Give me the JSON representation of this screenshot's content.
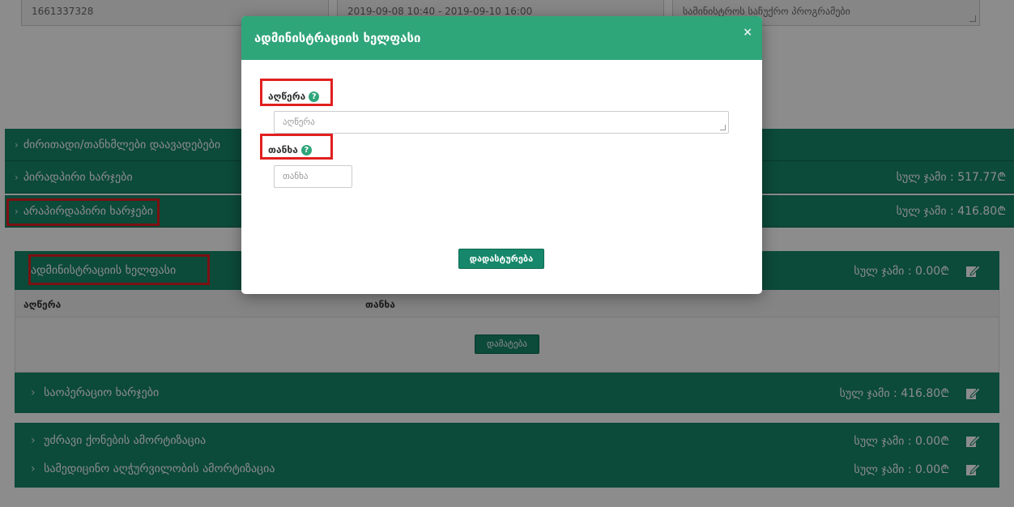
{
  "top_fields": {
    "id_value": "1661337328",
    "date_range": "2019-09-08 10:40 - 2019-09-10 16:00",
    "type_value": "სამინისტროს საჩუქრო პროგრამები"
  },
  "sections": {
    "main_funds": {
      "label": "ძირითადი/თანხმლები დაავადებები"
    },
    "direct_expenses": {
      "label": "პირადპირი ხარჯები",
      "total": "სულ ჯამი : 517.77₾"
    },
    "indirect_expenses": {
      "label": "არაპირდაპირი ხარჯები",
      "total": "სულ ჯამი : 416.80₾"
    }
  },
  "admin_section": {
    "label": "ადმინისტრაციის ხელფასი",
    "total": "სულ ჯამი : 0.00₾",
    "table_headers": [
      "აღწერა",
      "თანხა"
    ],
    "add_button": "დამატება"
  },
  "sub_sections": [
    {
      "label": "საოპერაციო ხარჯები",
      "total": "სულ ჯამი : 416.80₾"
    },
    {
      "label": "უძრავი ქონების ამორტიზაცია",
      "total": "სულ ჯამი : 0.00₾"
    },
    {
      "label": "სამედიცინო აღჭურვილობის ამორტიზაცია",
      "total": "სულ ჯამი : 0.00₾"
    }
  ],
  "modal": {
    "title": "ადმინისტრაციის ხელფასი",
    "close_glyph": "×",
    "description_label": "აღწერა",
    "description_placeholder": "აღწერა",
    "amount_label": "თანხა",
    "amount_placeholder": "თანხა",
    "help_glyph": "?",
    "save_button": "დადასტურება"
  },
  "colors": {
    "primary_green": "#16876a",
    "modal_header": "#2fa57a",
    "highlight_red": "#e0201f"
  },
  "icons": {
    "edit": "edit-icon",
    "help": "question-circle-icon",
    "close": "close-icon"
  }
}
